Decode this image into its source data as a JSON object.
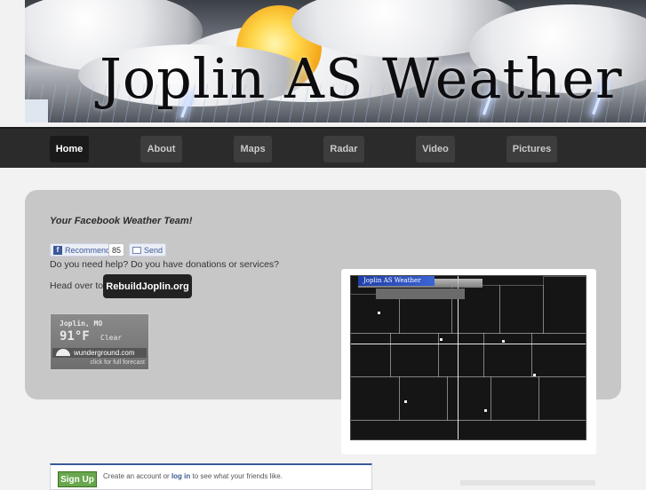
{
  "header": {
    "title": "Joplin AS Weather"
  },
  "nav": {
    "items": [
      {
        "label": "Home",
        "active": true
      },
      {
        "label": "About",
        "active": false
      },
      {
        "label": "Maps",
        "active": false
      },
      {
        "label": "Radar",
        "active": false
      },
      {
        "label": "Video",
        "active": false
      },
      {
        "label": "Pictures",
        "active": false
      }
    ]
  },
  "main": {
    "tagline": "Your Facebook Weather Team!",
    "facebook": {
      "recommend_label": "Recommend",
      "count": "85",
      "send_label": "Send"
    },
    "help_text": "Do you need help? Do you have donations or services?",
    "head_over": "Head over to",
    "rebuild_button": "RebuildJoplin.org"
  },
  "weather_widget": {
    "city": "Joplin, MO",
    "temperature": "91°F",
    "condition": "Clear",
    "brand": "wunderground.com",
    "forecast_link": "click for full forecast"
  },
  "radar": {
    "title": "Joplin AS Weather"
  },
  "signup": {
    "button": "Sign Up",
    "text_before": "Create an account or ",
    "login_link": "log in",
    "text_after": " to see what your friends like."
  },
  "colors": {
    "nav_bg": "#2b2b2b",
    "card_bg": "#c7c7c7",
    "facebook_blue": "#3b5998",
    "signup_green": "#69a74e"
  }
}
